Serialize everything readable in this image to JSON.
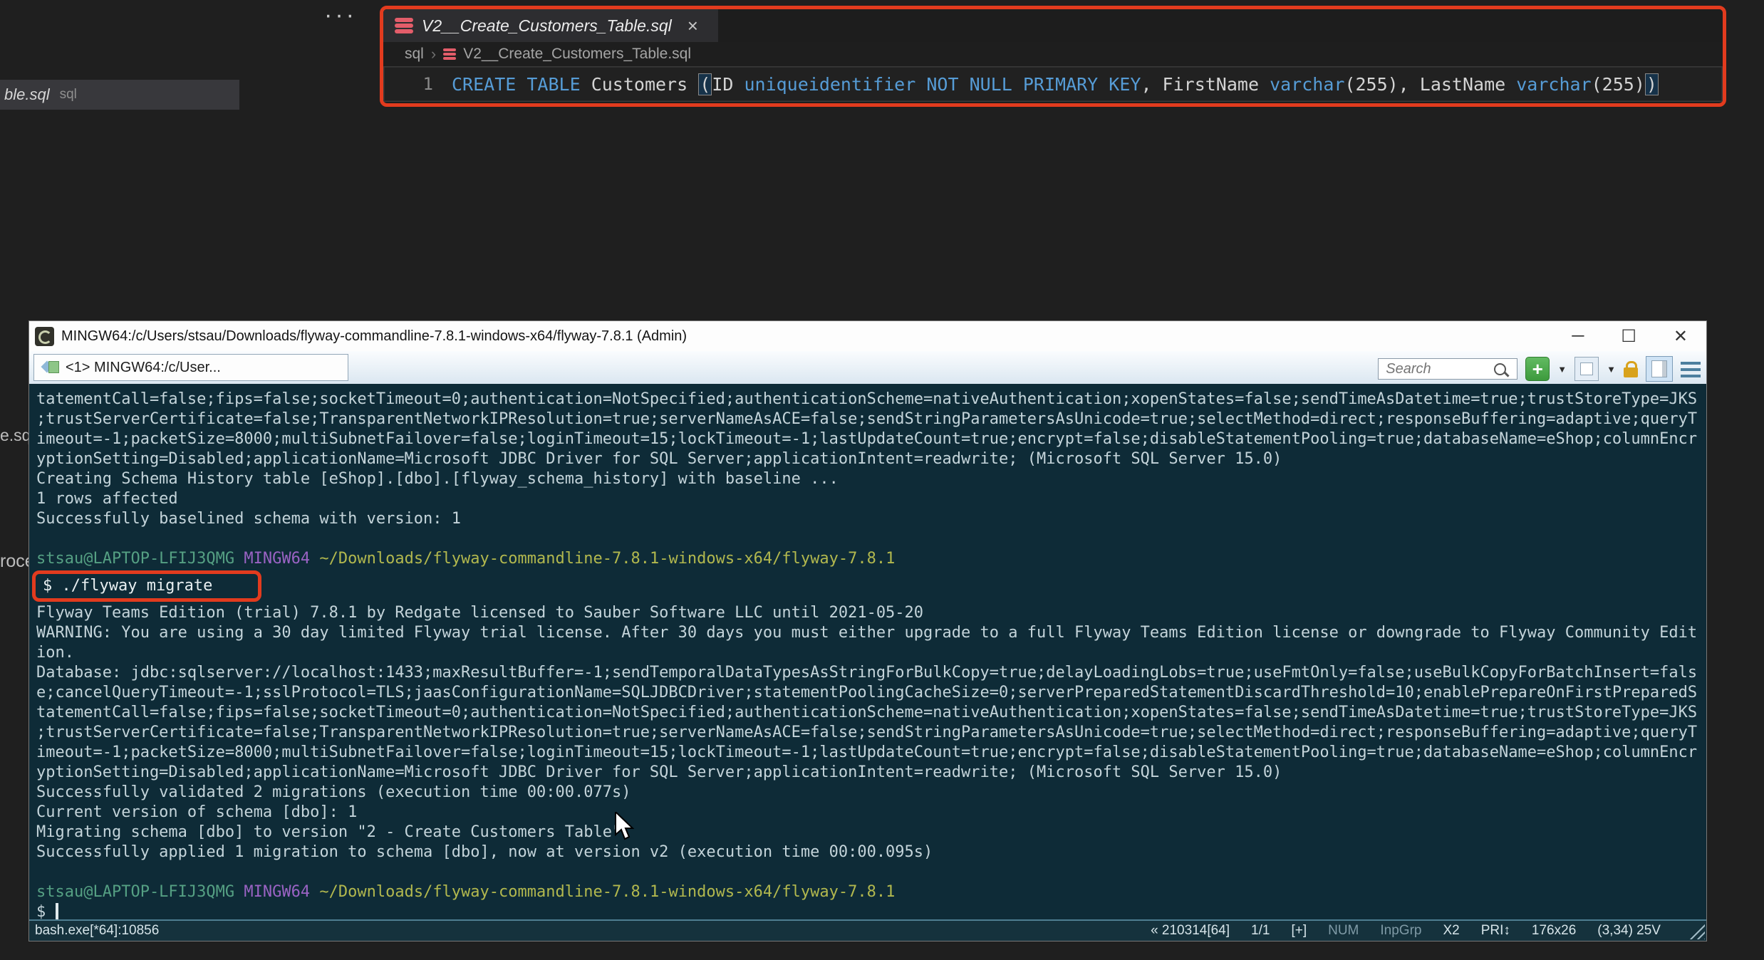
{
  "editor": {
    "background_tab": {
      "label": "ble.sql",
      "hint": "sql"
    },
    "more_actions": "···",
    "tab": {
      "title": "V2__Create_Customers_Table.sql",
      "close": "×"
    },
    "breadcrumb": {
      "folder": "sql",
      "separator": "›",
      "file": "V2__Create_Customers_Table.sql"
    },
    "line_number": "1",
    "code_tokens": [
      {
        "t": "CREATE",
        "c": "kw"
      },
      {
        "t": " "
      },
      {
        "t": "TABLE",
        "c": "kw"
      },
      {
        "t": " "
      },
      {
        "t": "Customers"
      },
      {
        "t": " "
      },
      {
        "t": "(",
        "c": "match"
      },
      {
        "t": "ID"
      },
      {
        "t": " "
      },
      {
        "t": "uniqueidentifier",
        "c": "kw"
      },
      {
        "t": " "
      },
      {
        "t": "NOT",
        "c": "kw"
      },
      {
        "t": " "
      },
      {
        "t": "NULL",
        "c": "kw"
      },
      {
        "t": " "
      },
      {
        "t": "PRIMARY",
        "c": "kw"
      },
      {
        "t": " "
      },
      {
        "t": "KEY",
        "c": "kw"
      },
      {
        "t": ", FirstName "
      },
      {
        "t": "varchar",
        "c": "kw"
      },
      {
        "t": "(255), LastName "
      },
      {
        "t": "varchar",
        "c": "kw"
      },
      {
        "t": "(255)"
      },
      {
        "t": ")",
        "c": "match"
      }
    ]
  },
  "background_fragments": {
    "fragment_1": "e.sq",
    "fragment_2": "roce"
  },
  "terminal": {
    "title": "MINGW64:/c/Users/stsau/Downloads/flyway-commandline-7.8.1-windows-x64/flyway-7.8.1 (Admin)",
    "window_buttons": {
      "minimize": "─",
      "maximize": "☐",
      "close": "✕"
    },
    "tab_label": "<1> MINGW64:/c/User...",
    "search_placeholder": "Search",
    "toolbar": {
      "plus_label": "+",
      "caret": "▼"
    },
    "lines": [
      {
        "seg": [
          {
            "t": "tatementCall=false;fips=false;socketTimeout=0;authentication=NotSpecified;authenticationScheme=nativeAuthentication;xopenStates=false;sendTimeAsDatetime=true;trustStoreType=JKS"
          }
        ]
      },
      {
        "seg": [
          {
            "t": ";trustServerCertificate=false;TransparentNetworkIPResolution=true;serverNameAsACE=false;sendStringParametersAsUnicode=true;selectMethod=direct;responseBuffering=adaptive;queryT"
          }
        ]
      },
      {
        "seg": [
          {
            "t": "imeout=-1;packetSize=8000;multiSubnetFailover=false;loginTimeout=15;lockTimeout=-1;lastUpdateCount=true;encrypt=false;disableStatementPooling=true;databaseName=eShop;columnEncr"
          }
        ]
      },
      {
        "seg": [
          {
            "t": "yptionSetting=Disabled;applicationName=Microsoft JDBC Driver for SQL Server;applicationIntent=readwrite; (Microsoft SQL Server 15.0)"
          }
        ]
      },
      {
        "seg": [
          {
            "t": "Creating Schema History table [eShop].[dbo].[flyway_schema_history] with baseline ..."
          }
        ]
      },
      {
        "seg": [
          {
            "t": "1 rows affected"
          }
        ]
      },
      {
        "seg": [
          {
            "t": "Successfully baselined schema with version: 1"
          }
        ]
      },
      {
        "seg": []
      },
      {
        "seg": [
          {
            "t": "stsau@LAPTOP-LFIJ3QMG",
            "c": "user"
          },
          {
            "t": " "
          },
          {
            "t": "MINGW64",
            "c": "arch"
          },
          {
            "t": " "
          },
          {
            "t": "~/Downloads/flyway-commandline-7.8.1-windows-x64/flyway-7.8.1",
            "c": "path"
          }
        ]
      },
      {
        "seg": [
          {
            "t": "$ ./flyway migrate",
            "c": "cmd"
          }
        ],
        "boxed": true
      },
      {
        "seg": [
          {
            "t": "Flyway Teams Edition (trial) 7.8.1 by Redgate licensed to Sauber Software LLC until 2021-05-20"
          }
        ]
      },
      {
        "seg": [
          {
            "t": "WARNING: You are using a 30 day limited Flyway trial license. After 30 days you must either upgrade to a full Flyway Teams Edition license or downgrade to Flyway Community Edit"
          }
        ]
      },
      {
        "seg": [
          {
            "t": "ion."
          }
        ]
      },
      {
        "seg": [
          {
            "t": "Database: jdbc:sqlserver://localhost:1433;maxResultBuffer=-1;sendTemporalDataTypesAsStringForBulkCopy=true;delayLoadingLobs=true;useFmtOnly=false;useBulkCopyForBatchInsert=fals"
          }
        ]
      },
      {
        "seg": [
          {
            "t": "e;cancelQueryTimeout=-1;sslProtocol=TLS;jaasConfigurationName=SQLJDBCDriver;statementPoolingCacheSize=0;serverPreparedStatementDiscardThreshold=10;enablePrepareOnFirstPreparedS"
          }
        ]
      },
      {
        "seg": [
          {
            "t": "tatementCall=false;fips=false;socketTimeout=0;authentication=NotSpecified;authenticationScheme=nativeAuthentication;xopenStates=false;sendTimeAsDatetime=true;trustStoreType=JKS"
          }
        ]
      },
      {
        "seg": [
          {
            "t": ";trustServerCertificate=false;TransparentNetworkIPResolution=true;serverNameAsACE=false;sendStringParametersAsUnicode=true;selectMethod=direct;responseBuffering=adaptive;queryT"
          }
        ]
      },
      {
        "seg": [
          {
            "t": "imeout=-1;packetSize=8000;multiSubnetFailover=false;loginTimeout=15;lockTimeout=-1;lastUpdateCount=true;encrypt=false;disableStatementPooling=true;databaseName=eShop;columnEncr"
          }
        ]
      },
      {
        "seg": [
          {
            "t": "yptionSetting=Disabled;applicationName=Microsoft JDBC Driver for SQL Server;applicationIntent=readwrite; (Microsoft SQL Server 15.0)"
          }
        ]
      },
      {
        "seg": [
          {
            "t": "Successfully validated 2 migrations (execution time 00:00.077s)"
          }
        ]
      },
      {
        "seg": [
          {
            "t": "Current version of schema [dbo]: 1"
          }
        ]
      },
      {
        "seg": [
          {
            "t": "Migrating schema [dbo] to version \"2 - Create Customers Table\""
          }
        ]
      },
      {
        "seg": [
          {
            "t": "Successfully applied 1 migration to schema [dbo], now at version v2 (execution time 00:00.095s)"
          }
        ]
      },
      {
        "seg": []
      },
      {
        "seg": [
          {
            "t": "stsau@LAPTOP-LFIJ3QMG",
            "c": "user"
          },
          {
            "t": " "
          },
          {
            "t": "MINGW64",
            "c": "arch"
          },
          {
            "t": " "
          },
          {
            "t": "~/Downloads/flyway-commandline-7.8.1-windows-x64/flyway-7.8.1",
            "c": "path"
          }
        ]
      },
      {
        "seg": [
          {
            "t": "$ "
          }
        ],
        "cursor": true
      }
    ],
    "status_left": "bash.exe[*64]:10856",
    "status_right": [
      {
        "t": "« 210314[64]",
        "dim": false
      },
      {
        "t": "1/1",
        "dim": false
      },
      {
        "t": "[+]",
        "dim": false
      },
      {
        "t": "NUM",
        "dim": true
      },
      {
        "t": "InpGrp",
        "dim": true
      },
      {
        "t": "X2",
        "dim": false
      },
      {
        "t": "PRI↕",
        "dim": false
      },
      {
        "t": "176x26",
        "dim": false
      },
      {
        "t": "(3,34) 25V",
        "dim": false
      }
    ]
  },
  "colors": {
    "annotation_red": "#e23b1e",
    "terminal_background": "#0e2b37",
    "keyword_blue": "#569cd6",
    "prompt_user_green": "#55a083",
    "prompt_arch_purple": "#9a63c4",
    "prompt_path_yellow": "#b2b84e"
  }
}
